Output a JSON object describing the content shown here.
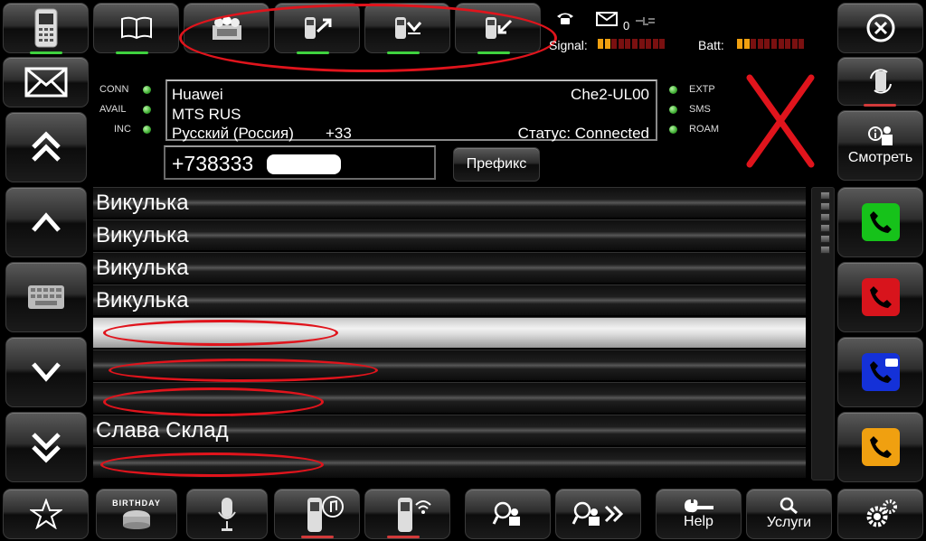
{
  "status": {
    "envelope_count": "0",
    "signal_label": "Signal:",
    "batt_label": "Batt:",
    "signal_level": 0.2,
    "batt_level": 0.2
  },
  "indicators_left": [
    {
      "label": "CONN"
    },
    {
      "label": "AVAIL"
    },
    {
      "label": "INC"
    }
  ],
  "indicators_right": [
    {
      "label": "EXTP"
    },
    {
      "label": "SMS"
    },
    {
      "label": "ROAM"
    }
  ],
  "device": {
    "brand": "Huawei",
    "model": "Che2-UL00",
    "operator": "MTS RUS",
    "language": "Русский (Россия)",
    "country_code": "+33",
    "status": "Статус: Connected"
  },
  "phone_input": {
    "value": "+738333"
  },
  "prefix_button": "Префикс",
  "view_button": "Смотреть",
  "contacts": [
    {
      "name": "Викулька"
    },
    {
      "name": "Викулька"
    },
    {
      "name": "Викулька"
    },
    {
      "name": "Викулька"
    },
    {
      "name": ""
    },
    {
      "name": ""
    },
    {
      "name": ""
    },
    {
      "name": "Слава Склад"
    },
    {
      "name": ""
    }
  ],
  "bottom_toolbar": {
    "help_label": "Help",
    "services_label": "Услуги",
    "birthday_text": "BIRTHDAY"
  },
  "colors": {
    "accent_red": "#e0141c",
    "indicator_green": "#3fd23f",
    "call_green": "#16c21a",
    "call_red": "#d8141c",
    "call_blue": "#1431d8",
    "call_orange": "#f0a010"
  }
}
